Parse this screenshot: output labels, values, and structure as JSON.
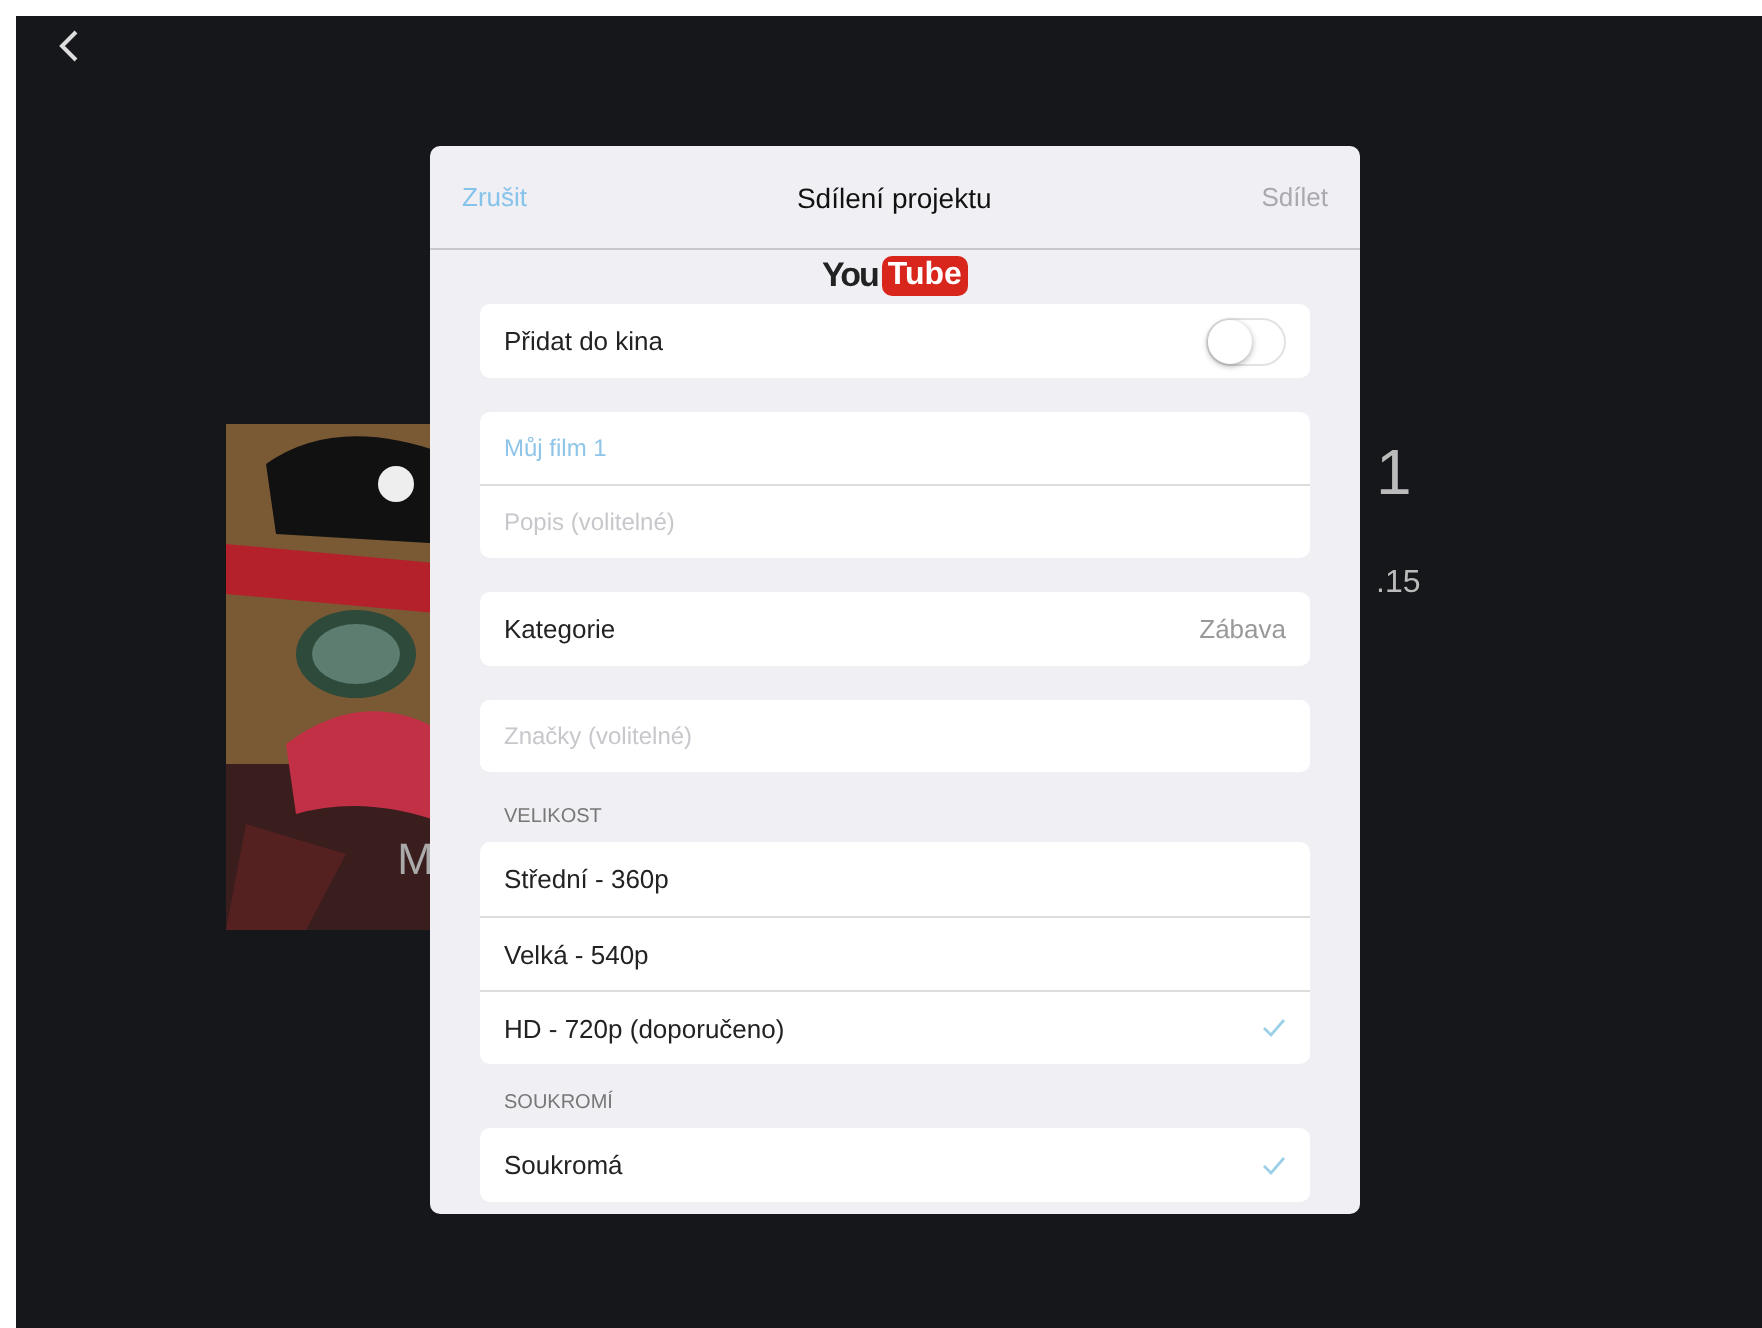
{
  "background": {
    "caption": "M",
    "info_title": "1",
    "info_date": ".15"
  },
  "dialog": {
    "cancel": "Zrušit",
    "title": "Sdílení projektu",
    "share": {
      "label": "Sdílet",
      "disabled": true
    },
    "logo": {
      "you": "You",
      "tube": "Tube"
    },
    "theater": {
      "label": "Přidat do kina",
      "on": false
    },
    "title_field": {
      "value": "Můj film 1"
    },
    "description_field": {
      "placeholder": "Popis (volitelné)"
    },
    "category": {
      "label": "Kategorie",
      "value": "Zábava"
    },
    "tags_field": {
      "placeholder": "Značky (volitelné)"
    },
    "size": {
      "heading": "VELIKOST",
      "options": [
        {
          "label": "Střední - 360p",
          "selected": false
        },
        {
          "label": "Velká - 540p",
          "selected": false
        },
        {
          "label": "HD - 720p (doporučeno)",
          "selected": true
        }
      ]
    },
    "privacy": {
      "heading": "SOUKROMÍ",
      "options": [
        {
          "label": "Soukromá",
          "selected": true
        }
      ]
    }
  }
}
